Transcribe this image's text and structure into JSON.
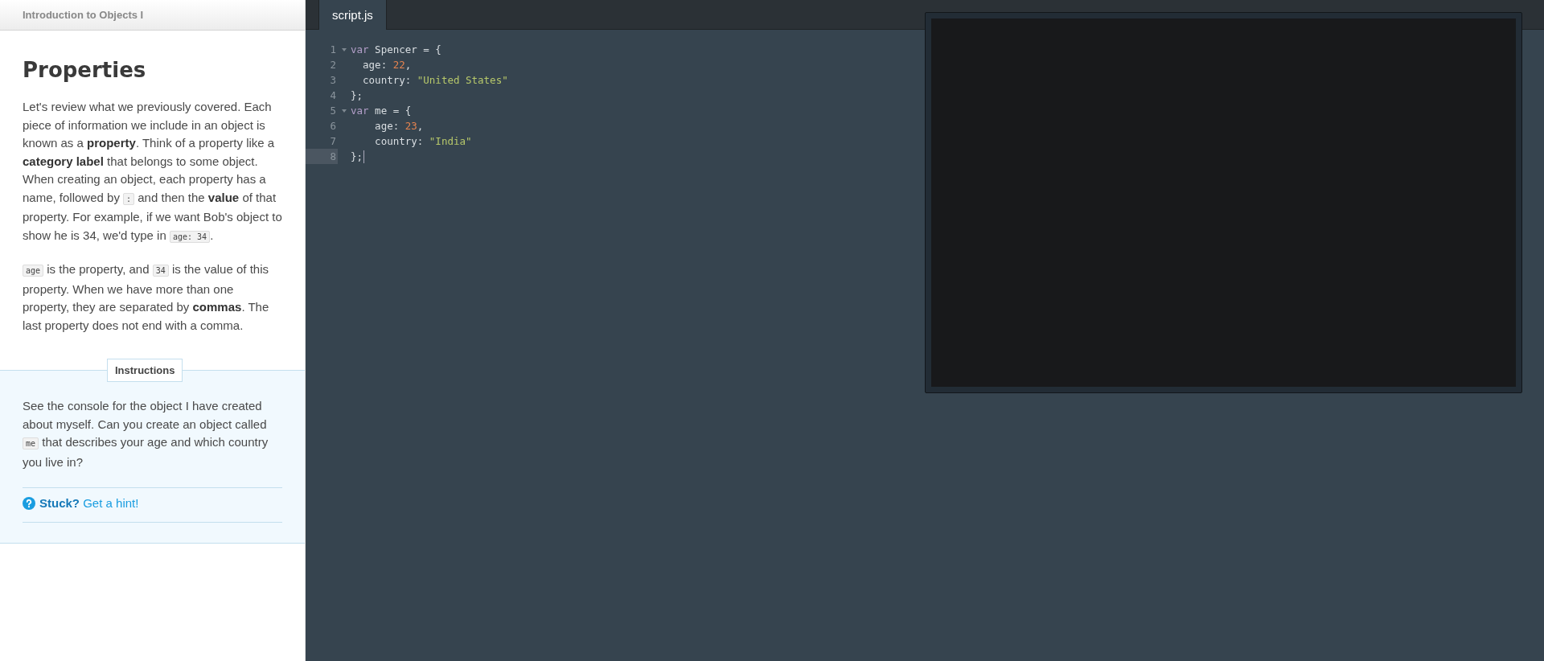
{
  "lesson": {
    "title": "Introduction to Objects I",
    "heading": "Properties",
    "paragraphs": [
      [
        {
          "kind": "text",
          "text": "Let's review what we previously covered. Each piece of information we include in an object is known as a **property**. Think of a property like a **category label** that belongs to some object. When creating an object, each property has a name, followed by "
        },
        {
          "kind": "code",
          "text": ":"
        },
        {
          "kind": "text",
          "text": " and then the **value** of that property. For example, if we want Bob's object to show he is 34, we'd type in "
        },
        {
          "kind": "code",
          "text": "age: 34"
        },
        {
          "kind": "text",
          "text": "."
        }
      ],
      [
        {
          "kind": "code",
          "text": "age"
        },
        {
          "kind": "text",
          "text": " is the property, and "
        },
        {
          "kind": "code",
          "text": "34"
        },
        {
          "kind": "text",
          "text": " is the value of this property. When we have more than one property, they are separated by **commas**. The last property does not end with a comma."
        }
      ]
    ]
  },
  "instructions": {
    "label": "Instructions",
    "paragraph": [
      {
        "kind": "text",
        "text": "See the console for the object I have created about myself. Can you create an object called "
      },
      {
        "kind": "code",
        "text": "me"
      },
      {
        "kind": "text",
        "text": " that describes your age and which country you live in?"
      }
    ],
    "hint": "**Stuck?** Get a hint!"
  },
  "editor": {
    "tabs": [
      {
        "label": "script.js",
        "selected": true
      }
    ],
    "lines": [
      {
        "number": "1",
        "foldable": true,
        "active": false,
        "tokens": [
          {
            "kind": "keyword",
            "text": "var"
          },
          {
            "kind": "plain",
            "text": " Spencer = {"
          }
        ]
      },
      {
        "number": "2",
        "foldable": false,
        "active": false,
        "tokens": [
          {
            "kind": "plain",
            "text": "  age: "
          },
          {
            "kind": "number",
            "text": "22"
          },
          {
            "kind": "plain",
            "text": ","
          }
        ]
      },
      {
        "number": "3",
        "foldable": false,
        "active": false,
        "tokens": [
          {
            "kind": "plain",
            "text": "  country: "
          },
          {
            "kind": "string",
            "text": "\"United States\""
          }
        ]
      },
      {
        "number": "4",
        "foldable": false,
        "active": false,
        "tokens": [
          {
            "kind": "plain",
            "text": "};"
          }
        ]
      },
      {
        "number": "5",
        "foldable": true,
        "active": false,
        "tokens": [
          {
            "kind": "keyword",
            "text": "var"
          },
          {
            "kind": "plain",
            "text": " me = {"
          }
        ]
      },
      {
        "number": "6",
        "foldable": false,
        "active": false,
        "tokens": [
          {
            "kind": "plain",
            "text": "    age: "
          },
          {
            "kind": "number",
            "text": "23"
          },
          {
            "kind": "plain",
            "text": ","
          }
        ]
      },
      {
        "number": "7",
        "foldable": false,
        "active": false,
        "tokens": [
          {
            "kind": "plain",
            "text": "    country: "
          },
          {
            "kind": "string",
            "text": "\"India\""
          }
        ]
      },
      {
        "number": "8",
        "foldable": false,
        "active": true,
        "tokens": [
          {
            "kind": "plain",
            "text": "};"
          }
        ]
      }
    ]
  }
}
